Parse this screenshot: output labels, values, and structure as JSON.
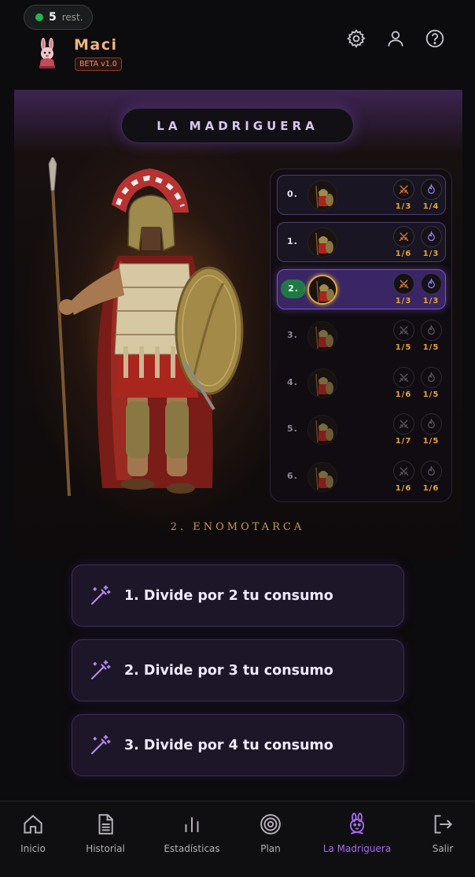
{
  "header": {
    "status_count": "5",
    "status_unit": "rest.",
    "user_name": "Maci",
    "beta_badge": "BETA v1.0",
    "icons": [
      "gear-icon",
      "user-icon",
      "help-icon"
    ]
  },
  "hero": {
    "title": "LA MADRIGUERA",
    "current_rank_caption": "2. ENOMOTARCA"
  },
  "ranks": [
    {
      "num": "0.",
      "stat1": "1/3",
      "stat2": "1/4",
      "state": "unlocked"
    },
    {
      "num": "1.",
      "stat1": "1/6",
      "stat2": "1/3",
      "state": "unlocked"
    },
    {
      "num": "2.",
      "stat1": "1/3",
      "stat2": "1/3",
      "state": "current"
    },
    {
      "num": "3.",
      "stat1": "1/5",
      "stat2": "1/5",
      "state": "locked"
    },
    {
      "num": "4.",
      "stat1": "1/6",
      "stat2": "1/5",
      "state": "locked"
    },
    {
      "num": "5.",
      "stat1": "1/7",
      "stat2": "1/5",
      "state": "locked"
    },
    {
      "num": "6.",
      "stat1": "1/6",
      "stat2": "1/6",
      "state": "locked"
    }
  ],
  "benefits": [
    "1. Divide por 2 tu consumo",
    "2. Divide por 3 tu consumo",
    "3. Divide por 4 tu consumo"
  ],
  "nav": [
    {
      "label": "Inicio",
      "icon": "home-icon"
    },
    {
      "label": "Historial",
      "icon": "document-icon"
    },
    {
      "label": "Estadísticas",
      "icon": "bar-chart-icon"
    },
    {
      "label": "Plan",
      "icon": "target-icon"
    },
    {
      "label": "La Madriguera",
      "icon": "rabbit-icon",
      "active": true
    },
    {
      "label": "Salir",
      "icon": "logout-icon"
    }
  ],
  "colors": {
    "accent_purple": "#a66bf2",
    "gold": "#e9a52e",
    "status_green": "#25b352",
    "user_orange": "#f3b47c"
  }
}
